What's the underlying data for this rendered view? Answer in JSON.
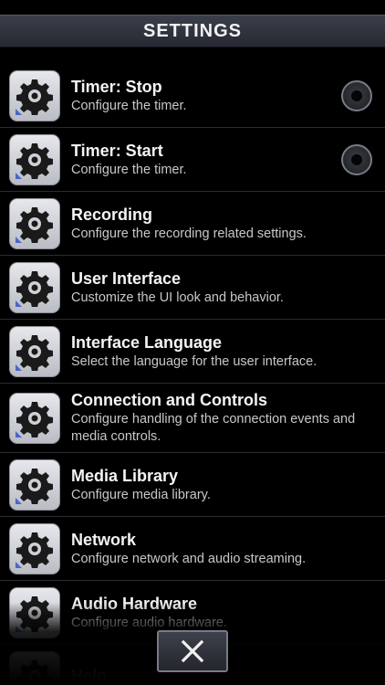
{
  "header": {
    "title": "SETTINGS"
  },
  "items": [
    {
      "title": "Timer: Stop",
      "subtitle": "Configure the timer."
    },
    {
      "title": "Timer: Start",
      "subtitle": "Configure the timer."
    },
    {
      "title": "Recording",
      "subtitle": "Configure the recording related settings."
    },
    {
      "title": "User Interface",
      "subtitle": "Customize the UI look and behavior."
    },
    {
      "title": "Interface Language",
      "subtitle": "Select the language for the user interface."
    },
    {
      "title": "Connection and Controls",
      "subtitle": "Configure handling of the connection events and media controls."
    },
    {
      "title": "Media Library",
      "subtitle": "Configure media library."
    },
    {
      "title": "Network",
      "subtitle": "Configure network and audio streaming."
    },
    {
      "title": "Audio Hardware",
      "subtitle": "Configure audio hardware."
    },
    {
      "title": "Help",
      "subtitle": ""
    }
  ],
  "icons": {
    "item_icon": "gear-icon",
    "close": "close-icon"
  },
  "colors": {
    "background": "#000000",
    "header": "#2f323b",
    "accent_mark": "#4b66c8"
  }
}
